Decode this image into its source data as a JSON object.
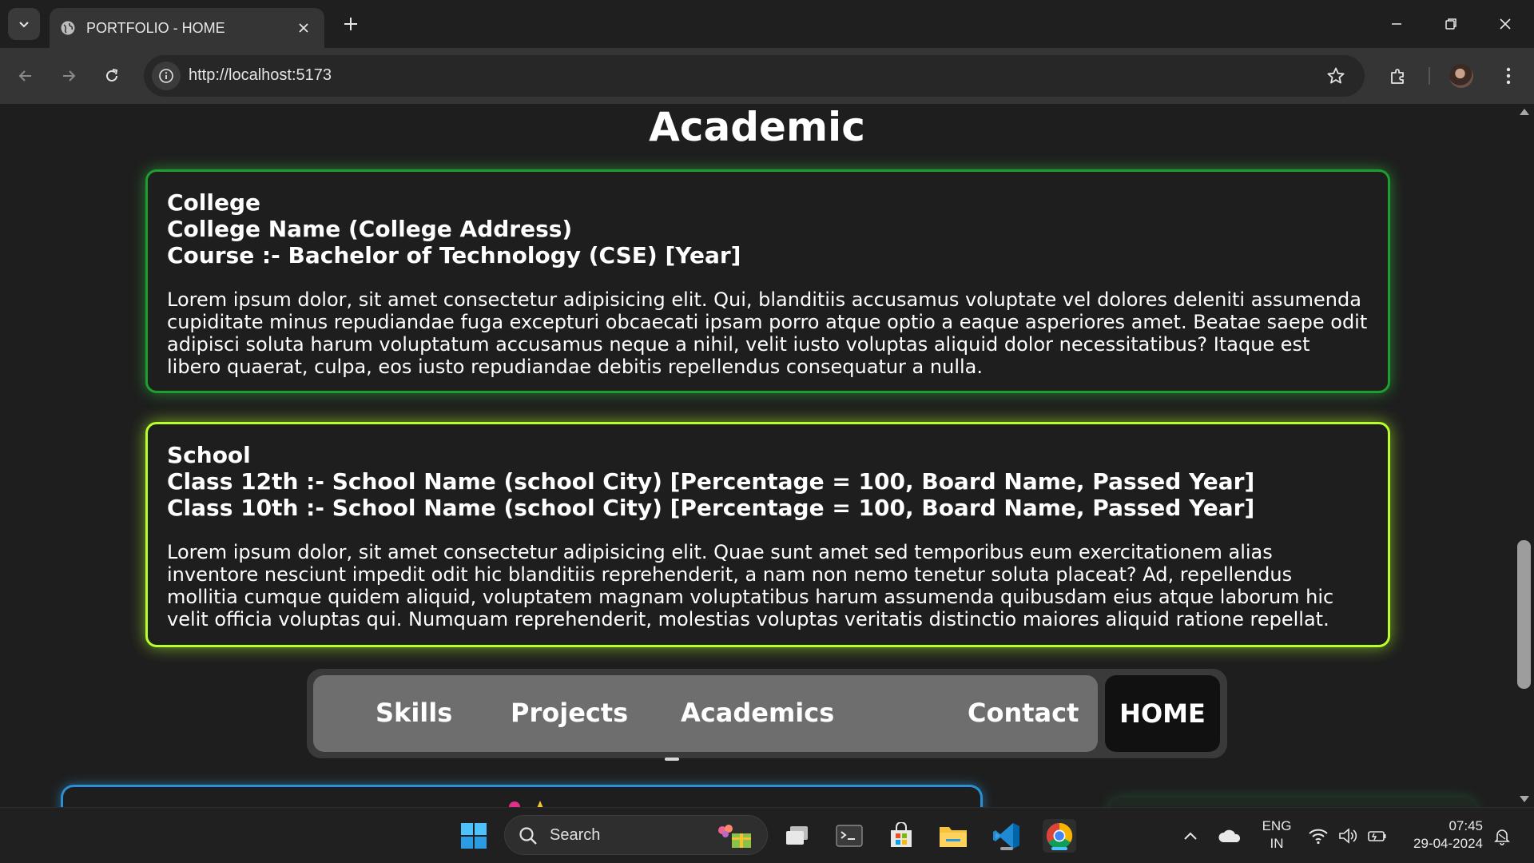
{
  "browser": {
    "tab_title": "PORTFOLIO - HOME",
    "url": "http://localhost:5173"
  },
  "page": {
    "section_title": "Academic",
    "college": {
      "heading": "College",
      "name_line": "College Name (College Address)",
      "course_line": "Course :- Bachelor of Technology (CSE) [Year]",
      "description": "Lorem ipsum dolor, sit amet consectetur adipisicing elit. Qui, blanditiis accusamus voluptate vel dolores deleniti assumenda cupiditate minus repudiandae fuga excepturi obcaecati ipsam porro atque optio a eaque asperiores amet. Beatae saepe odit adipisci soluta harum voluptatum accusamus neque a nihil, velit iusto voluptas aliquid dolor necessitatibus? Itaque est libero quaerat, culpa, eos iusto repudiandae debitis repellendus consequatur a nulla."
    },
    "school": {
      "heading": "School",
      "class12_line": "Class 12th :- School Name (school City) [Percentage = 100, Board Name, Passed Year]",
      "class10_line": "Class 10th :- School Name (school City) [Percentage = 100, Board Name, Passed Year]",
      "description": "Lorem ipsum dolor, sit amet consectetur adipisicing elit. Quae sunt amet sed temporibus eum exercitationem alias inventore nesciunt impedit odit hic blanditiis reprehenderit, a nam non nemo tenetur soluta placeat? Ad, repellendus mollitia cumque quidem aliquid, voluptatem magnam voluptatibus harum assumenda quibusdam eius atque laborum hic velit officia voluptas qui. Numquam reprehenderit, molestias voluptas veritatis distinctio maiores aliquid ratione repellat."
    },
    "nav": {
      "skills": "Skills",
      "projects": "Projects",
      "academics": "Academics",
      "contact": "Contact",
      "home": "HOME"
    }
  },
  "taskbar": {
    "search_label": "Search",
    "lang_line1": "ENG",
    "lang_line2": "IN",
    "time": "07:45",
    "date": "29-04-2024"
  },
  "colors": {
    "college_border": "#1f9d2e",
    "school_border": "#b6ff2a",
    "nav_inner": "#6e6e6e",
    "home_button": "#111111"
  }
}
